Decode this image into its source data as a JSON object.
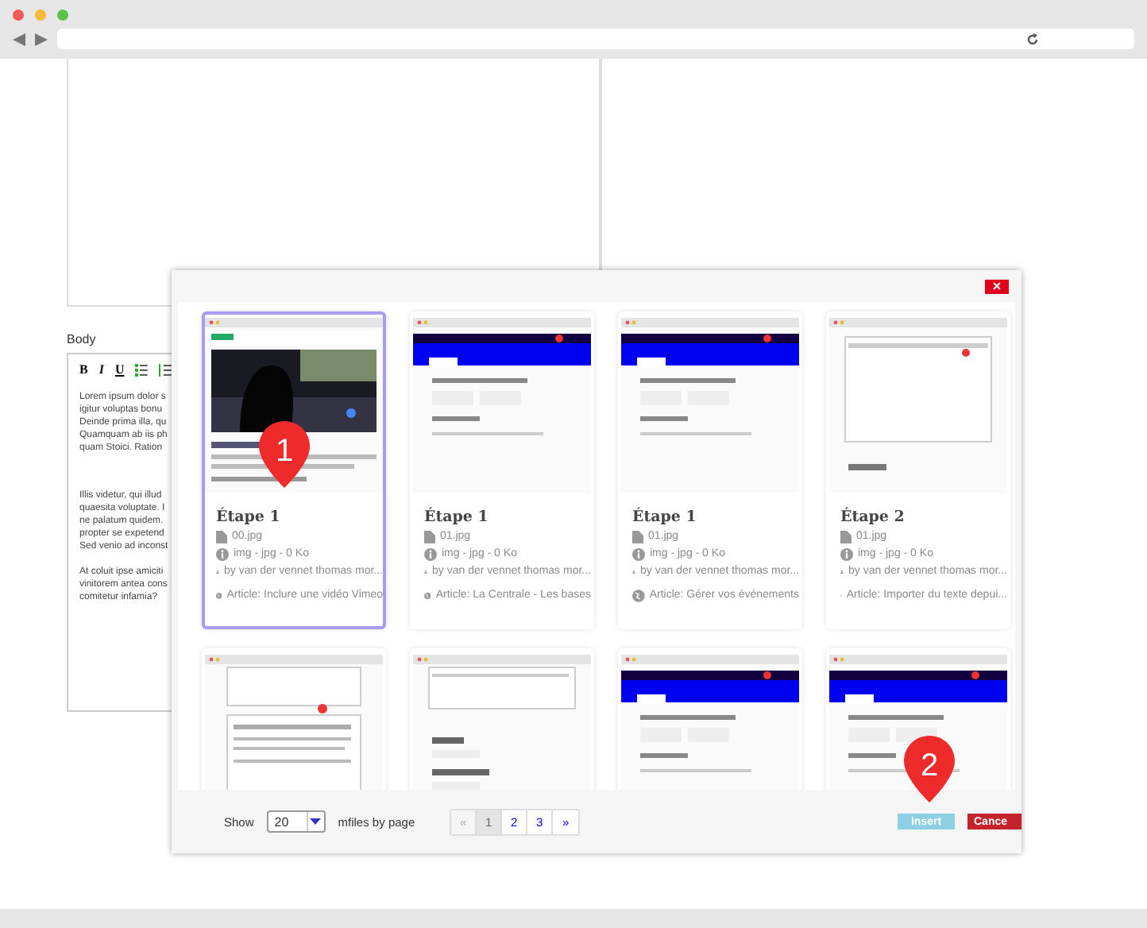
{
  "editor": {
    "label": "Body",
    "toolbar": [
      "B",
      "I",
      "U"
    ],
    "paragraphs": [
      "Lorem ipsum dolor s\nigitur voluptas bonu\nDeinde prima illa, qu\nQuamquam ab iis ph\nquam Stoici. Ration",
      "Illis videtur, qui illud\nquaesita voluptate. I\nne palatum quidem.\npropter se expetend\nSed venio ad inconst",
      "At coluit ipse amiciti\nvinitorem antea cons\ncomitetur infamia?"
    ]
  },
  "dialog": {
    "close": "×",
    "cards": [
      {
        "selected": true,
        "title": "Étape 1",
        "file": "00.jpg",
        "meta": "img - jpg - 0 Ko",
        "author": "by van der vennet thomas mor...",
        "article": "Article: Inclure une vidéo Vimeo"
      },
      {
        "selected": false,
        "title": "Étape 1",
        "file": "01.jpg",
        "meta": "img - jpg - 0 Ko",
        "author": "by van der vennet thomas mor...",
        "article": "Article: La Centrale - Les bases"
      },
      {
        "selected": false,
        "title": "Étape 1",
        "file": "01.jpg",
        "meta": "img - jpg - 0 Ko",
        "author": "by van der vennet thomas mor...",
        "article": "Article: Gérer vos événements"
      },
      {
        "selected": false,
        "title": "Étape 2",
        "file": "01.jpg",
        "meta": "img - jpg - 0 Ko",
        "author": "by van der vennet thomas mor...",
        "article": "Article: Importer du texte depui..."
      },
      {
        "selected": false
      },
      {
        "selected": false
      },
      {
        "selected": false
      },
      {
        "selected": false
      }
    ],
    "footer": {
      "show_label": "Show",
      "per_page": "20",
      "suffix": "mfiles by page",
      "pages": [
        {
          "label": "«",
          "selected": false,
          "disabled": true
        },
        {
          "label": "1",
          "selected": true,
          "disabled": false
        },
        {
          "label": "2",
          "selected": false,
          "disabled": false
        },
        {
          "label": "3",
          "selected": false,
          "disabled": false
        },
        {
          "label": "»",
          "selected": false,
          "disabled": false
        }
      ],
      "insert": "Insert",
      "cancel": "Cance"
    }
  },
  "markers": [
    {
      "label": "1"
    },
    {
      "label": "2"
    }
  ]
}
